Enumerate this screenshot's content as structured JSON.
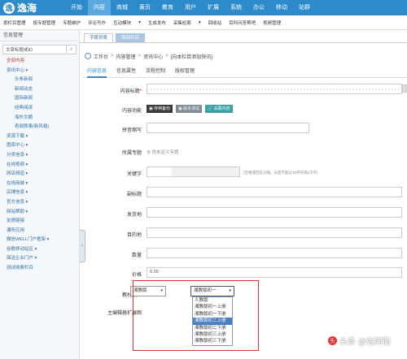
{
  "brand": {
    "logo_text": "逸海",
    "logo_mark": "逸"
  },
  "main_nav": [
    "开始",
    "内容",
    "商城",
    "黄页",
    "教育",
    "用户",
    "扩展",
    "系统",
    "办公",
    "移动",
    "站群"
  ],
  "main_nav_active": 1,
  "sub_nav": [
    "按栏目管理",
    "按专题管理",
    "专题维护",
    "评论写作",
    "互动模块",
    "▾",
    "生成发布",
    "采集检索",
    "▾",
    "回收站",
    "百科问答帮吧",
    "视频管理"
  ],
  "sidebar": {
    "header": "信息管理",
    "search_placeholder": "文章标题或ID",
    "items": [
      {
        "label": "全部内容",
        "child": false
      },
      {
        "label": "资讯中心 ▾",
        "child": false
      },
      {
        "label": "头条新闻",
        "child": true
      },
      {
        "label": "新闻动态",
        "child": true
      },
      {
        "label": "国际新闻",
        "child": true
      },
      {
        "label": "经典阅读",
        "child": true
      },
      {
        "label": "海外文摘",
        "child": true
      },
      {
        "label": "奇闻轶事(新风格)",
        "child": true
      },
      {
        "label": "资源下载 ▾",
        "child": false
      },
      {
        "label": "图库中心 ▾",
        "child": false
      },
      {
        "label": "分类信息 ▾",
        "child": false
      },
      {
        "label": "在线视频 ▾",
        "child": false
      },
      {
        "label": "网店频道 ▾",
        "child": false
      },
      {
        "label": "在线商城 ▾",
        "child": false
      },
      {
        "label": "店铺信息 ▾",
        "child": false
      },
      {
        "label": "官方信息 ▾",
        "child": false
      },
      {
        "label": "网站帮助 ▾",
        "child": false
      },
      {
        "label": "友情链接",
        "child": false
      },
      {
        "label": "课所应用",
        "child": false
      },
      {
        "label": "微信WELL门户框架 ▾",
        "child": false
      },
      {
        "label": "谷歌移动站区 ▾",
        "child": false
      },
      {
        "label": "简洁企业门户 ▾",
        "child": false
      },
      {
        "label": "测试收费栏目",
        "child": false
      }
    ]
  },
  "page_tabs": [
    {
      "label": "字段列表",
      "active": false
    },
    {
      "label": "添加栏目",
      "active": true
    }
  ],
  "breadcrumb": [
    "工作台",
    "内容管理",
    "资讯中心",
    "[向本栏目添加快讯]"
  ],
  "form_tabs": [
    {
      "label": "内容信息",
      "active": true
    },
    {
      "label": "信息属性",
      "active": false
    },
    {
      "label": "流程控制",
      "active": false
    },
    {
      "label": "版权管理",
      "active": false
    }
  ],
  "form": {
    "title_label": "内容标题",
    "title_required": "*",
    "function_label": "内容功能",
    "function_buttons": [
      {
        "label": "存档备份",
        "color": "#3a3a3a"
      },
      {
        "label": "版本测试",
        "color": "#7f8b95"
      },
      {
        "label": "关联内容",
        "color": "#3aa3a8"
      }
    ],
    "pinyin_label": "拼音缩写",
    "topic_label": "所属专题",
    "topic_value": "尚未定义专题",
    "keyword_label": "关键字",
    "keyword_hint": "(空格或回车分隔，长度不超过10字符或5汉字)",
    "subtitle_label": "副标题",
    "origin_label": "发货地",
    "dest_label": "目的地",
    "quantity_label": "数量",
    "price_label": "价格",
    "price_value": "0.00",
    "textbook_label": "教材版本",
    "textbook_select_1": "湘教版",
    "textbook_select_2": "湘教版初一",
    "editor_label": "主编辑器扩展图"
  },
  "dropdown_options": [
    {
      "label": "人教版",
      "hl": false
    },
    {
      "label": "湘教版初一上册",
      "hl": false
    },
    {
      "label": "湘教版初一下册",
      "hl": false
    },
    {
      "label": "湘教版初二上册",
      "hl": true
    },
    {
      "label": "湘教版初二下册",
      "hl": false
    },
    {
      "label": "湘教版初三上册",
      "hl": false
    },
    {
      "label": "湘教版初三下册",
      "hl": false
    }
  ],
  "watermark": "头条 @佐阿衡",
  "colors": {
    "topbar": "#2e8bcb",
    "active_nav": "#5ba9e0",
    "highlight": "#4a7ec0",
    "red_box": "#dd3333"
  }
}
